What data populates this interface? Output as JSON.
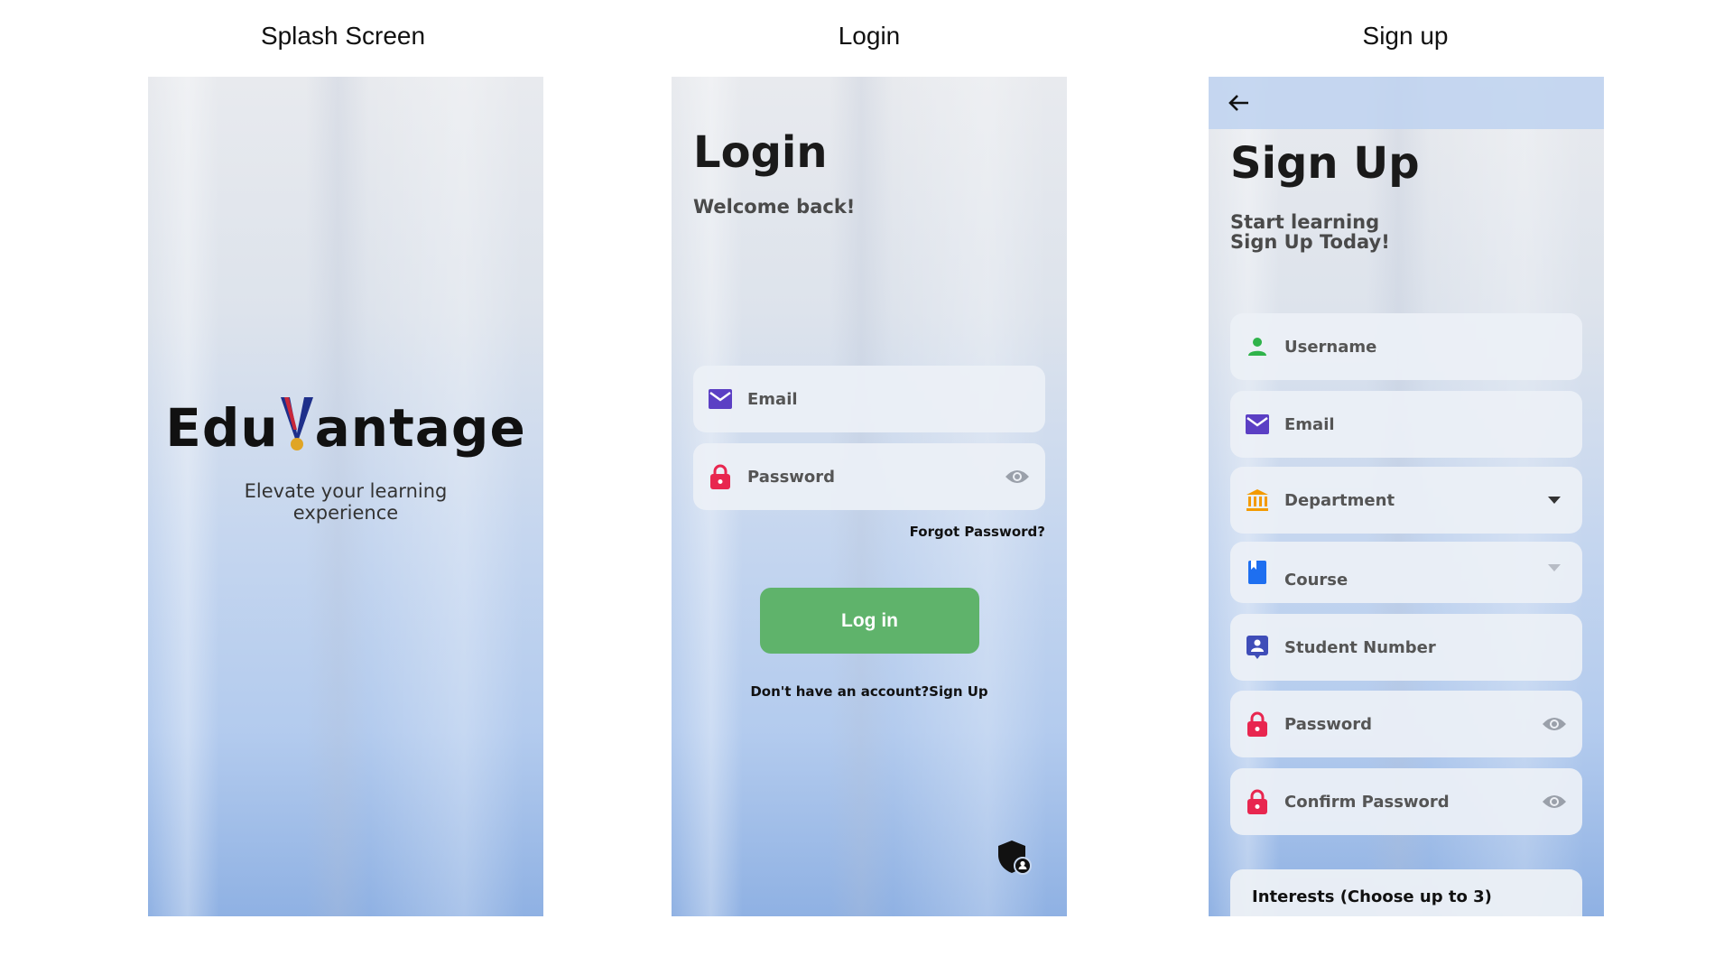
{
  "captions": {
    "splash": "Splash Screen",
    "login": "Login",
    "signup": "Sign up"
  },
  "splash": {
    "logo_pre": "Edu",
    "logo_v": "V",
    "logo_post": "antage",
    "tagline_line1": "Elevate your learning",
    "tagline_line2": "experience"
  },
  "login": {
    "title": "Login",
    "subtitle": "Welcome back!",
    "email_label": "Email",
    "password_label": "Password",
    "forgot": "Forgot Password?",
    "login_button": "Log in",
    "no_account": "Don't have an account?",
    "sign_up_link": "Sign Up"
  },
  "signup": {
    "title": "Sign Up",
    "subtitle_line1": "Start learning",
    "subtitle_line2": "Sign Up Today!",
    "fields": {
      "username": "Username",
      "email": "Email",
      "department": "Department",
      "course": "Course",
      "student_number": "Student Number",
      "password": "Password",
      "confirm_password": "Confirm Password"
    },
    "interests": "Interests (Choose up to 3)"
  },
  "icons": {
    "email": "mail-icon",
    "password": "lock-icon",
    "visibility": "eye-icon",
    "username": "person-icon",
    "department": "bank-icon",
    "course": "book-icon",
    "student_number": "id-badge-icon",
    "dropdown": "caret-down-icon",
    "back": "arrow-left-icon",
    "admin": "admin-shield-icon"
  },
  "colors": {
    "login_button": "#5fb36b",
    "mail_icon": "#5b3fc4",
    "lock_icon": "#e8264f",
    "person_icon": "#2fb34a",
    "bank_icon": "#f39a00",
    "book_icon": "#1e6ff0",
    "badge_icon": "#3f4db8"
  }
}
